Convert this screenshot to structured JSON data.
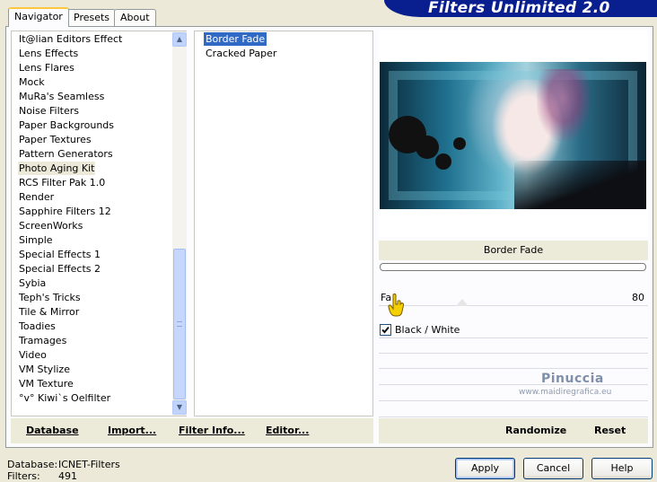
{
  "app": {
    "title": "Filters Unlimited 2.0"
  },
  "tabs": [
    {
      "label": "Navigator",
      "active": true
    },
    {
      "label": "Presets",
      "active": false
    },
    {
      "label": "About",
      "active": false
    }
  ],
  "categories": [
    "It@lian Editors Effect",
    "Lens Effects",
    "Lens Flares",
    "Mock",
    "MuRa's Seamless",
    "Noise Filters",
    "Paper Backgrounds",
    "Paper Textures",
    "Pattern Generators",
    "Photo Aging Kit",
    "RCS Filter Pak 1.0",
    "Render",
    "Sapphire Filters 12",
    "ScreenWorks",
    "Simple",
    "Special Effects 1",
    "Special Effects 2",
    "Sybia",
    "Teph's Tricks",
    "Tile & Mirror",
    "Toadies",
    "Tramages",
    "Video",
    "VM Stylize",
    "VM Texture",
    "°v° Kiwi`s Oelfilter"
  ],
  "selected_category": "Photo Aging Kit",
  "filters": [
    "Border Fade",
    "Cracked Paper"
  ],
  "selected_filter": "Border Fade",
  "params": {
    "title": "Border Fade",
    "slider_label": "Fa",
    "slider_value": "80",
    "checkbox_label": "Black / White",
    "checkbox_checked": true
  },
  "watermark": {
    "name": "Pinuccia",
    "url": "www.maidiregrafica.eu"
  },
  "left_bar": {
    "database": "Database",
    "import": "Import...",
    "filter_info": "Filter Info...",
    "editor": "Editor..."
  },
  "right_bar": {
    "randomize": "Randomize",
    "reset": "Reset"
  },
  "status": {
    "database_label": "Database:",
    "database_value": "ICNET-Filters",
    "filters_label": "Filters:",
    "filters_value": "491"
  },
  "buttons": {
    "apply": "Apply",
    "cancel": "Cancel",
    "help": "Help"
  },
  "colors": {
    "banner": "#0a1f8f",
    "selection": "#316ac5",
    "tab_highlight": "#ffc83c"
  }
}
